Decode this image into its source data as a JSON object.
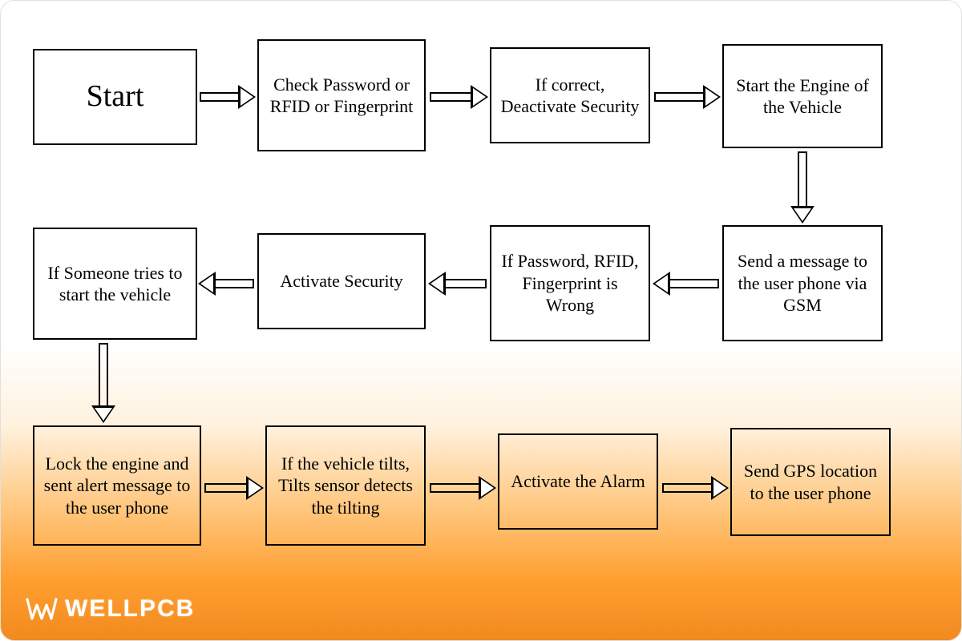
{
  "nodes": {
    "start": "Start",
    "check": "Check Password or RFID or Fingerprint",
    "correct": "If correct, Deactivate Security",
    "engine": "Start the Engine of the Vehicle",
    "gsm": "Send a message to the user phone via GSM",
    "wrong": "If Password, RFID, Fingerprint is Wrong",
    "activate": "Activate Security",
    "someone": "If Someone tries to start the vehicle",
    "lock": "Lock the engine and sent alert message to the user phone",
    "tilt": "If the vehicle tilts, Tilts sensor detects the tilting",
    "alarm": "Activate the Alarm",
    "gps": "Send GPS location to the user phone"
  },
  "brand": "WELLPCB",
  "flow_order": [
    "start",
    "check",
    "correct",
    "engine",
    "gsm",
    "wrong",
    "activate",
    "someone",
    "lock",
    "tilt",
    "alarm",
    "gps"
  ]
}
